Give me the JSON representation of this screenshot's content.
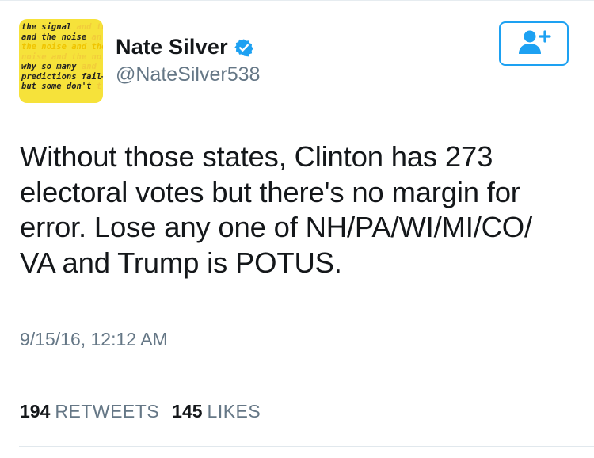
{
  "avatar": {
    "lines": [
      {
        "dark": "the signal",
        "faint": " and th"
      },
      {
        "dark": "and the noise",
        "faint": " an"
      },
      {
        "dark": "",
        "faint": "the noise and the"
      },
      {
        "dark": "",
        "faint": "noise and the noi"
      },
      {
        "dark": "why so many",
        "faint": " and"
      },
      {
        "dark": "predictions fail–",
        "faint": ""
      },
      {
        "dark": "but some don't",
        "faint": " t"
      }
    ],
    "bg_color": "#f6e23a"
  },
  "user": {
    "display_name": "Nate Silver",
    "handle": "@NateSilver538",
    "verified_icon": "verified-badge-icon"
  },
  "follow_button": {
    "icon": "add-user-icon",
    "color": "#1da1f2"
  },
  "tweet": {
    "text": "Without those states, Clinton has 273 electoral votes but there's no margin for error. Lose any one of NH/PA/WI/MI/CO/ VA and Trump is POTUS.",
    "lines": [
      "Without those states, Clinton has 273",
      "electoral votes but there's no margin for",
      "error. Lose any one of NH/PA/WI/MI/CO/",
      "VA and Trump is POTUS."
    ],
    "timestamp": "9/15/16, 12:12 AM"
  },
  "stats": {
    "retweets_count": "194",
    "retweets_label": "RETWEETS",
    "likes_count": "145",
    "likes_label": "LIKES"
  }
}
